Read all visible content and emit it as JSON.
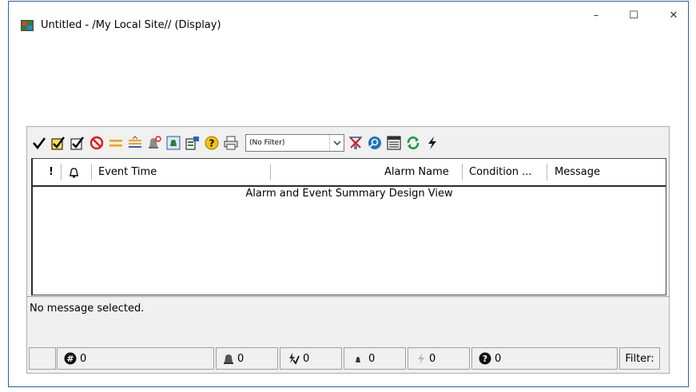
{
  "window": {
    "title": "Untitled - /My Local Site// (Display)",
    "minimize_glyph": "–",
    "maximize_glyph": "☐",
    "close_glyph": "✕"
  },
  "toolbar": {
    "filter": {
      "value": "(No Filter)"
    },
    "icons": [
      "ack-check-icon",
      "ack-all-icon",
      "ack-page-icon",
      "no-entry-icon",
      "equal-lines-icon",
      "priority-lines-icon",
      "alarm-bell-icon",
      "display-bell-icon",
      "properties-icon",
      "help-icon",
      "print-icon",
      "filter-clear-icon",
      "query-icon",
      "details-icon",
      "refresh-icon",
      "lightning-icon"
    ]
  },
  "grid": {
    "columns": {
      "priority": "!",
      "state": "",
      "event_time": "Event Time",
      "alarm_name": "Alarm Name",
      "condition": "Condition ...",
      "message": "Message"
    },
    "design_view_text": "Alarm and Event Summary Design View"
  },
  "message_area": {
    "text": "No message selected."
  },
  "status": {
    "total": "0",
    "alarms": "0",
    "acknowledged": "0",
    "unacked": "0",
    "events": "0",
    "unknown": "0",
    "filter_label": "Filter:"
  },
  "colors": {
    "window_border": "#2d5fa8",
    "toolbar_bg": "#f0f0f0",
    "accent_blue": "#1e73be",
    "no_entry_red": "#e01818",
    "equal_orange": "#f0a000",
    "refresh_green": "#14a03c"
  }
}
